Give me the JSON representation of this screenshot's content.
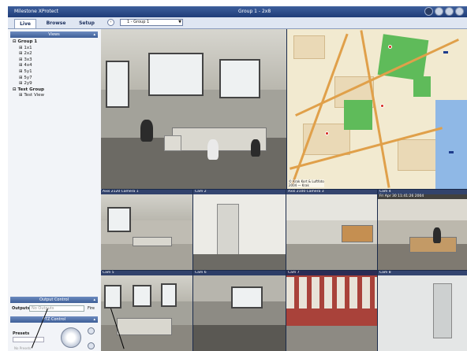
{
  "window": {
    "app_title": "Milestone XProtect",
    "center_title": "Group 1 - 2x8"
  },
  "tabs": [
    {
      "label": "Live",
      "active": true
    },
    {
      "label": "Browse",
      "active": false
    },
    {
      "label": "Setup",
      "active": false
    }
  ],
  "group_selector": {
    "value": "1 - Group 1"
  },
  "sidebar": {
    "views_header": "Views",
    "tree": [
      {
        "label": "Group 1",
        "children": [
          "1x1",
          "2x2",
          "3x3",
          "4x4",
          "5y1",
          "5y7",
          "2y9"
        ]
      },
      {
        "label": "Test Group",
        "children": [
          "Test View"
        ]
      }
    ],
    "output_header": "Output Control",
    "outputs_label": "Outputs",
    "outputs_placeholder": "No Outputs",
    "fire_label": "Fire",
    "ptz_header": "PTZ Control",
    "presets_label": "Presets",
    "presets_value": "No Presets"
  },
  "cameras": {
    "row2_1": "Axis 2120 Camera 1",
    "row2_2": "Cam 2",
    "row2_3": "Axis 2100 Camera 3",
    "row2_4": "Cam 4",
    "row2_4_ts": "Fri Apr 30 11:41:26 2004",
    "row3_1": "Cam 5",
    "row3_2": "Cam 6",
    "row3_3": "Cam 7",
    "row3_4": "Cam 8"
  },
  "map": {
    "caption_line1": "© Krak Kort & Luftfoto",
    "caption_line2": "2004 — Krak"
  },
  "colors": {
    "title_bar": "#2a4a8a",
    "sidebar_bg": "#f2f4f8",
    "panel_header": "#4f6fa8",
    "map_park": "#5fbb5a",
    "map_street": "#e0a04a"
  }
}
